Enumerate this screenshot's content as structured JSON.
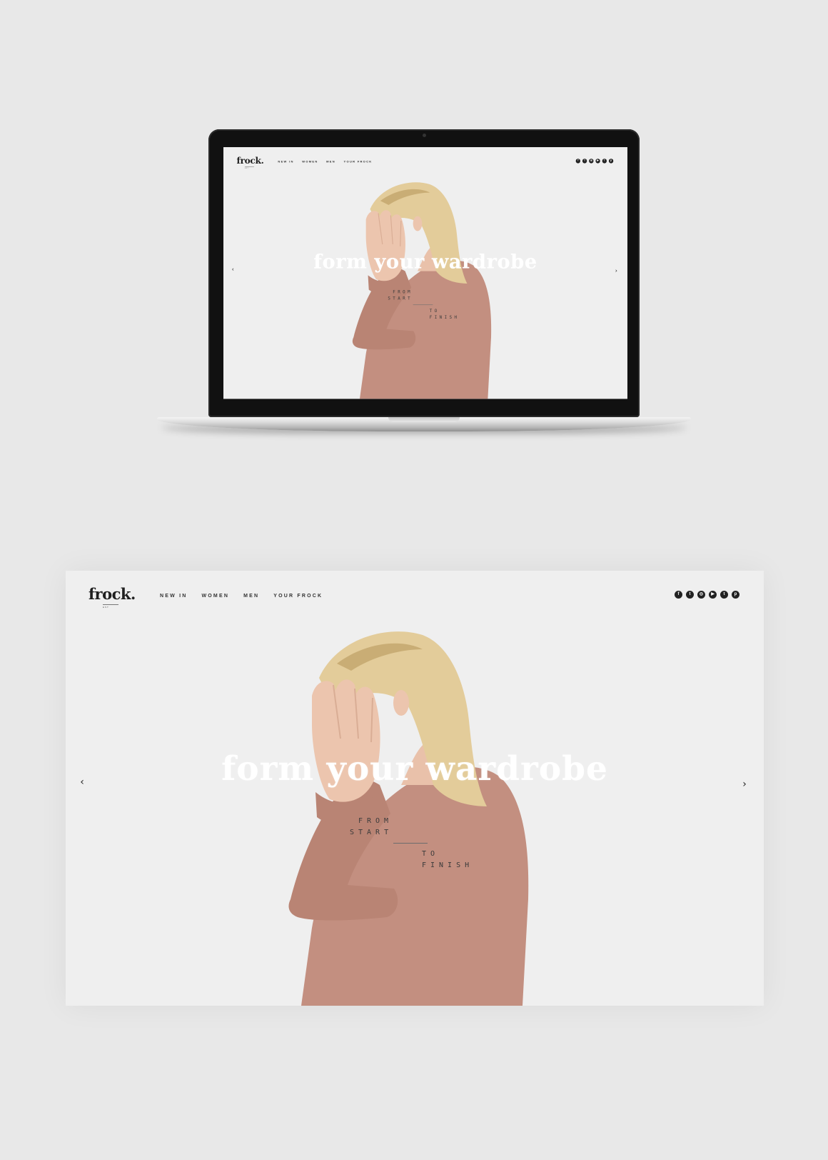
{
  "site": {
    "logo": "frock.",
    "logo_sub": "EST",
    "nav": [
      "NEW IN",
      "WOMEN",
      "MEN",
      "YOUR FROCK"
    ],
    "social_icons": [
      "facebook-icon",
      "twitter-icon",
      "instagram-icon",
      "youtube-icon",
      "tumblr-icon",
      "pinterest-icon"
    ],
    "social_glyphs": [
      "f",
      "t",
      "◎",
      "▶",
      "t",
      "p"
    ],
    "hero": {
      "headline": "form your wardrobe",
      "from": "FROM",
      "start": "START",
      "to": "TO",
      "finish": "FINISH"
    },
    "arrow_prev": "‹",
    "arrow_next": "›"
  },
  "colors": {
    "background": "#e8e8e8",
    "page": "#efefef",
    "sweater": "#c38f80",
    "hair": "#e3cc9a",
    "skin": "#ecc5ae"
  }
}
